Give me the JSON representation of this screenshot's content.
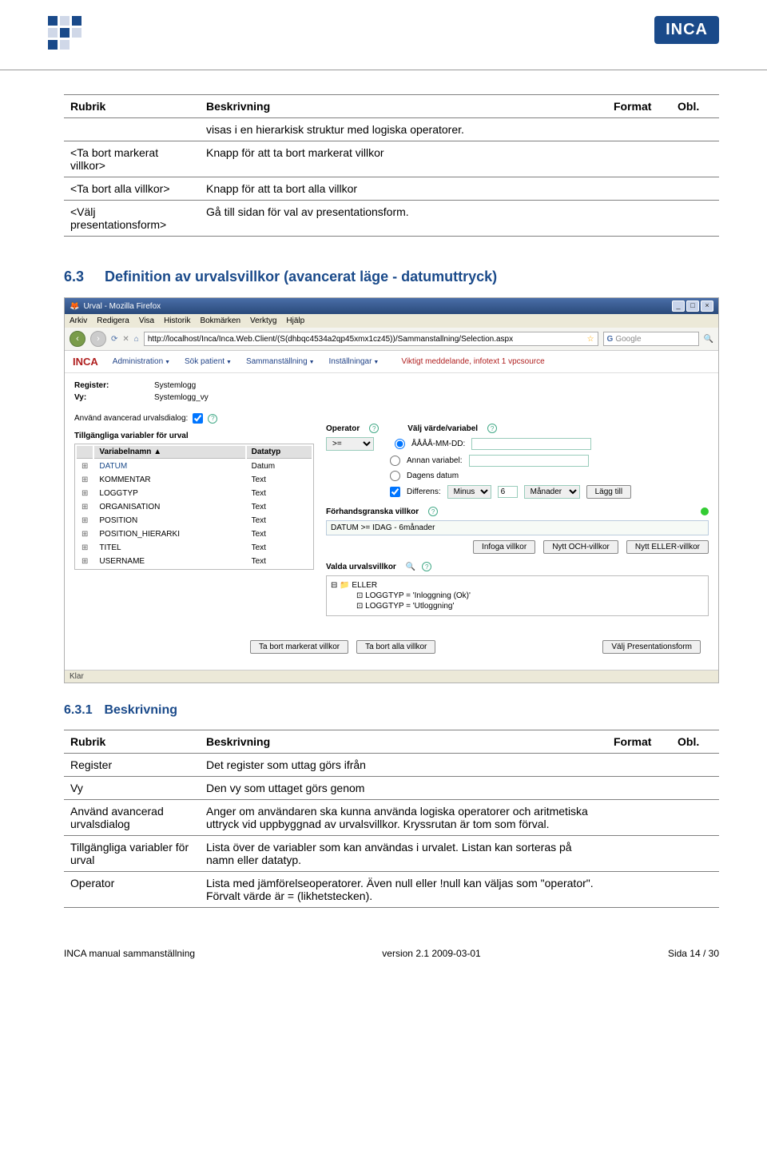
{
  "header": {
    "logo": "INCA"
  },
  "table1": {
    "headers": [
      "Rubrik",
      "Beskrivning",
      "Format",
      "Obl."
    ],
    "intro_row": "visas i en hierarkisk struktur med logiska operatorer.",
    "rows": [
      {
        "rubrik": "<Ta bort markerat villkor>",
        "besk": "Knapp för att ta bort markerat villkor",
        "format": "",
        "obl": ""
      },
      {
        "rubrik": "<Ta bort alla villkor>",
        "besk": "Knapp för att ta bort alla villkor",
        "format": "",
        "obl": ""
      },
      {
        "rubrik": "<Välj presentationsform>",
        "besk": "Gå till sidan för val av presentationsform.",
        "format": "",
        "obl": ""
      }
    ]
  },
  "section63_num": "6.3",
  "section63": "Definition av urvalsvillkor (avancerat läge - datumuttryck)",
  "section631_num": "6.3.1",
  "section631": "Beskrivning",
  "screenshot": {
    "window_title": "Urval - Mozilla Firefox",
    "menus": [
      "Arkiv",
      "Redigera",
      "Visa",
      "Historik",
      "Bokmärken",
      "Verktyg",
      "Hjälp"
    ],
    "url": "http://localhost/Inca/Inca.Web.Client/(S(dhbqc4534a2qp45xmx1cz45))/Sammanstallning/Selection.aspx",
    "search_placeholder": "Google",
    "inca_menus": [
      "Administration",
      "Sök patient",
      "Sammanställning",
      "Inställningar"
    ],
    "notice": "Viktigt meddelande, infotext 1 vpcsource",
    "register_lbl": "Register:",
    "register_val": "Systemlogg",
    "vy_lbl": "Vy:",
    "vy_val": "Systemlogg_vy",
    "adv_lbl": "Använd avancerad urvalsdialog:",
    "vars_title": "Tillgängliga variabler för urval",
    "vars_head": [
      "Variabelnamn ▲",
      "Datatyp"
    ],
    "vars": [
      [
        "DATUM",
        "Datum"
      ],
      [
        "KOMMENTAR",
        "Text"
      ],
      [
        "LOGGTYP",
        "Text"
      ],
      [
        "ORGANISATION",
        "Text"
      ],
      [
        "POSITION",
        "Text"
      ],
      [
        "POSITION_HIERARKI",
        "Text"
      ],
      [
        "TITEL",
        "Text"
      ],
      [
        "USERNAME",
        "Text"
      ]
    ],
    "operator_lbl": "Operator",
    "operator_val": ">=",
    "valj_lbl": "Välj värde/variabel",
    "opt_date": "ÅÅÅÅ-MM-DD:",
    "opt_var": "Annan variabel:",
    "opt_today": "Dagens datum",
    "diff_lbl": "Differens:",
    "diff_sign": "Minus",
    "diff_n": "6",
    "diff_unit": "Månader",
    "btn_add": "Lägg till",
    "preview_title": "Förhandsgranska villkor",
    "preview_text": "DATUM >= IDAG - 6månader",
    "btn_insert": "Infoga villkor",
    "btn_and": "Nytt OCH-villkor",
    "btn_or": "Nytt ELLER-villkor",
    "valda_title": "Valda urvalsvillkor",
    "tree_root": "ELLER",
    "tree_c1": "LOGGTYP = 'Inloggning (Ok)'",
    "tree_c2": "LOGGTYP = 'Utloggning'",
    "btn_rm1": "Ta bort markerat villkor",
    "btn_rm_all": "Ta bort alla villkor",
    "btn_present": "Välj Presentationsform",
    "status": "Klar"
  },
  "table2": {
    "headers": [
      "Rubrik",
      "Beskrivning",
      "Format",
      "Obl."
    ],
    "rows": [
      {
        "rubrik": "Register",
        "besk": "Det register som uttag görs ifrån",
        "format": "",
        "obl": ""
      },
      {
        "rubrik": "Vy",
        "besk": "Den vy som uttaget görs genom",
        "format": "",
        "obl": ""
      },
      {
        "rubrik": "Använd avancerad urvalsdialog",
        "besk": "Anger om användaren ska kunna använda logiska operatorer och aritmetiska uttryck vid uppbyggnad av urvalsvillkor. Kryssrutan är tom som förval.",
        "format": "",
        "obl": ""
      },
      {
        "rubrik": "Tillgängliga variabler för urval",
        "besk": "Lista över de variabler som kan användas i urvalet. Listan kan sorteras på namn eller datatyp.",
        "format": "",
        "obl": ""
      },
      {
        "rubrik": "Operator",
        "besk": "Lista med jämförelseoperatorer. Även null eller !null kan väljas som \"operator\". Förvalt värde är = (likhetstecken).",
        "format": "",
        "obl": ""
      }
    ]
  },
  "footer": {
    "left": "INCA manual sammanställning",
    "center": "version 2.1  2009-03-01",
    "right": "Sida 14 / 30"
  }
}
